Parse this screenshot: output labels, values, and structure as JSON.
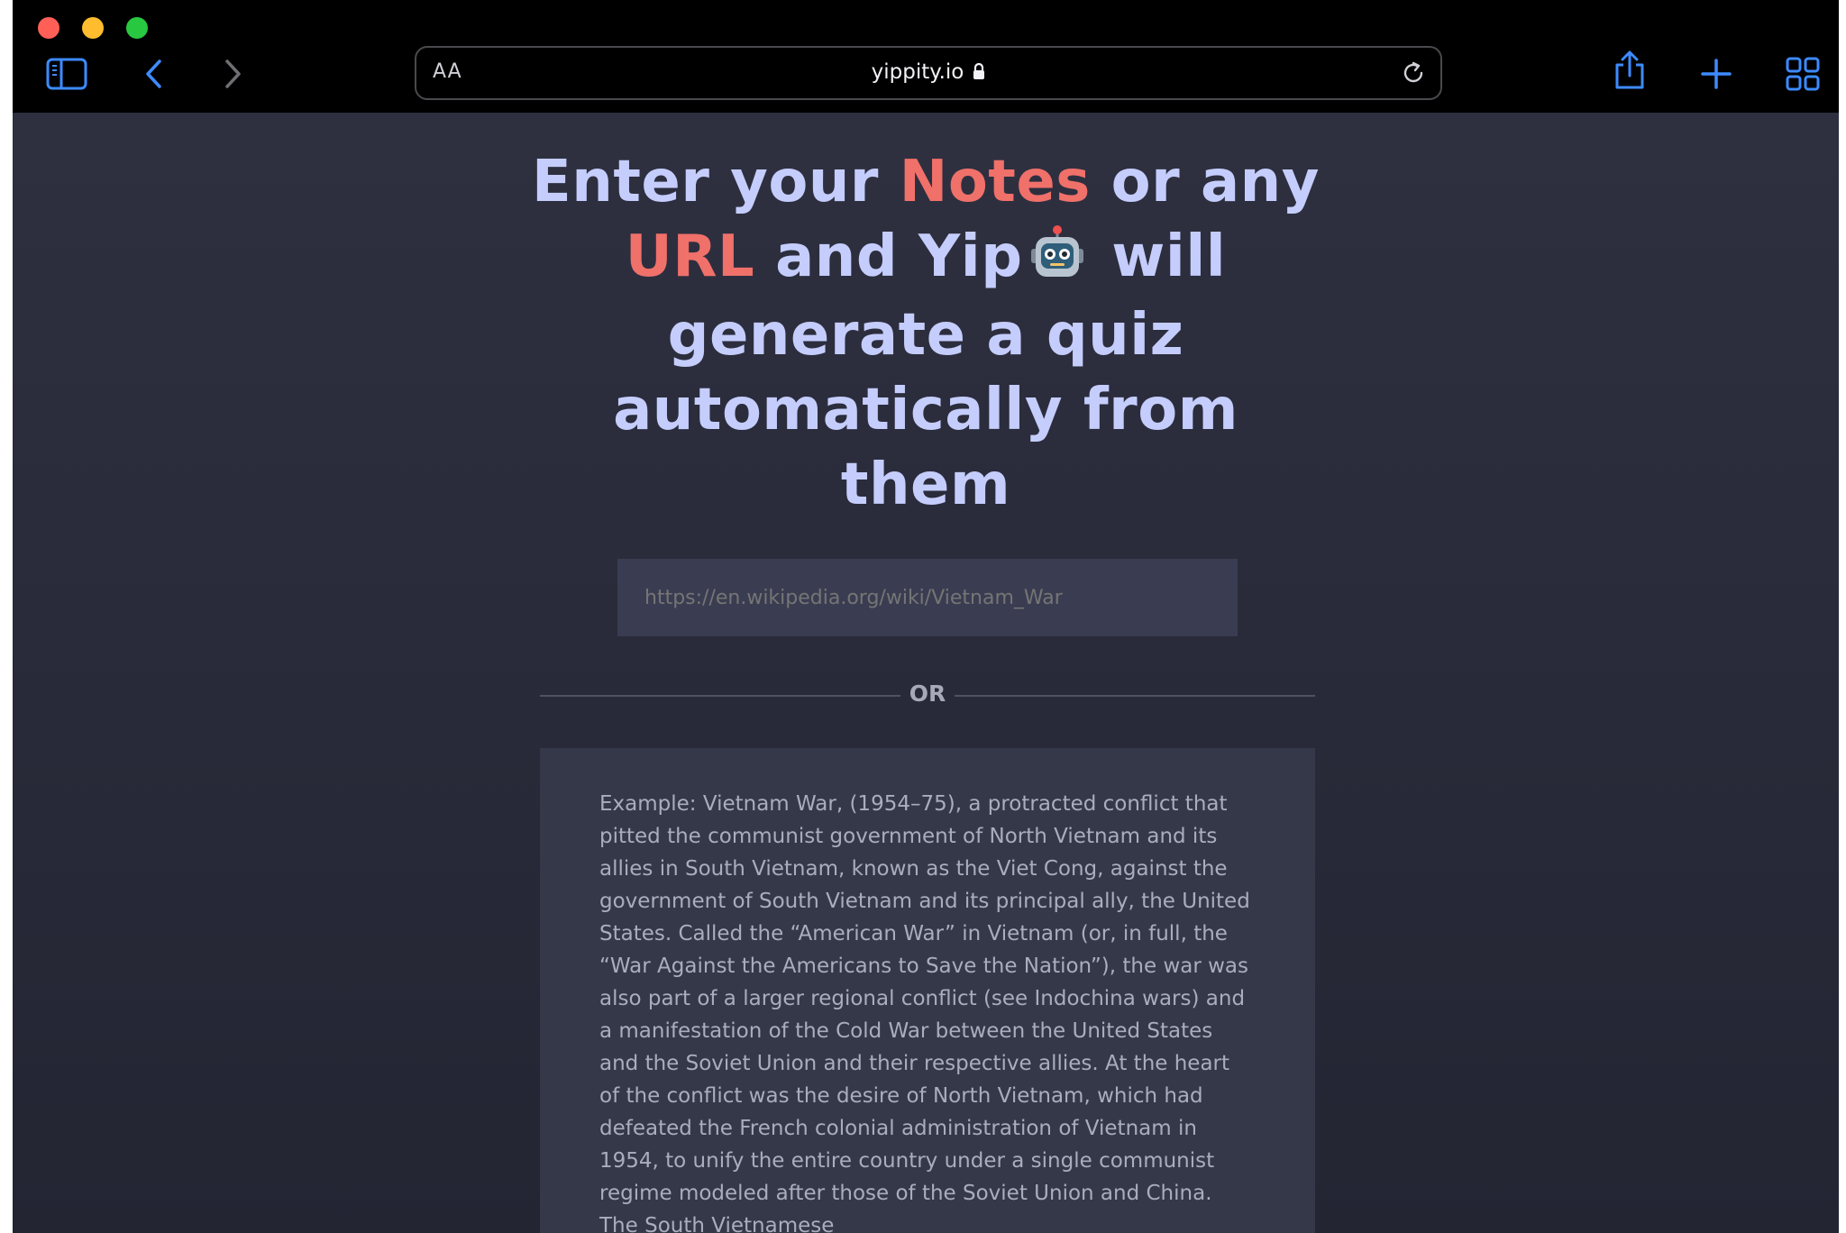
{
  "browser": {
    "address": {
      "text_size_label": "AA",
      "url": "yippity.io"
    }
  },
  "page": {
    "headline": {
      "part1": "Enter your ",
      "notes": "Notes",
      "part2": " or any ",
      "url": "URL",
      "part3": " and Yip",
      "part4": " will generate a quiz automatically from them"
    },
    "url_field": {
      "placeholder": "https://en.wikipedia.org/wiki/Vietnam_War"
    },
    "divider_label": "OR",
    "notes_field": {
      "placeholder": "Example: Vietnam War, (1954–75), a protracted conflict that pitted the communist government of North Vietnam and its allies in South Vietnam, known as the Viet Cong, against the government of South Vietnam and its principal ally, the United States. Called the “American War” in Vietnam (or, in full, the “War Against the Americans to Save the Nation”), the war was also part of a larger regional conflict (see Indochina wars) and a manifestation of the Cold War between the United States and the Soviet Union and their respective allies.  At the heart of the conflict was the desire of North Vietnam, which had defeated the French colonial administration of Vietnam in 1954, to unify the entire country under a single communist regime modeled after those of the Soviet Union and China. The South Vietnamese"
    }
  },
  "colors": {
    "headline": "#c5cdfc",
    "accent": "#f0706a",
    "toolbar_blue": "#3d8bff",
    "background": "#2b2d3c"
  },
  "icons": {
    "sidebar": "sidebar-icon",
    "back": "chevron-left-icon",
    "forward": "chevron-right-icon",
    "lock": "lock-icon",
    "reload": "reload-icon",
    "share": "share-icon",
    "new_tab": "plus-icon",
    "tabs": "tab-overview-icon",
    "robot": "robot-icon"
  }
}
